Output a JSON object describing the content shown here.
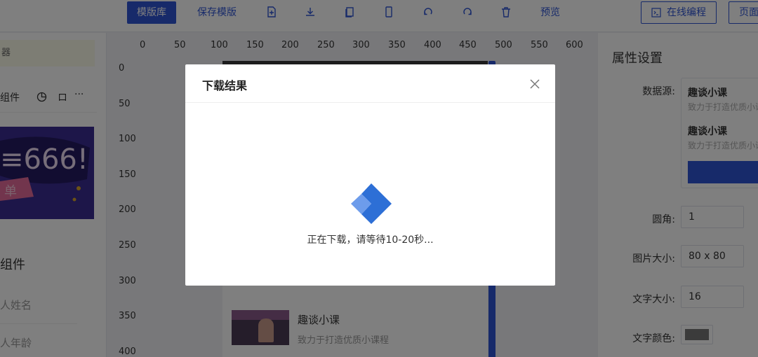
{
  "toolbar": {
    "template_lib": "模版库",
    "save_template": "保存模版",
    "preview": "预览",
    "online_coding": "在线编程",
    "page": "页面"
  },
  "left_panel": {
    "tab_component": "组件",
    "tab_more": "···",
    "banner_text": "≡666!",
    "banner_ribbon": "单",
    "components_title": "组件",
    "fields": [
      "人姓名",
      "人年龄"
    ]
  },
  "ruler": {
    "x_ticks": [
      "0",
      "50",
      "100",
      "150",
      "200",
      "250",
      "300",
      "350",
      "400",
      "450",
      "500",
      "550",
      "600"
    ],
    "y_ticks": [
      "0",
      "50",
      "100",
      "150",
      "200",
      "250",
      "300",
      "350",
      "400"
    ]
  },
  "canvas": {
    "item_title": "趣谈小课",
    "item_subtitle": "致力于打造优质小课程"
  },
  "right_panel": {
    "title": "属性设置",
    "datasource_label": "数据源:",
    "datasource_items": [
      {
        "title": "趣谈小课",
        "subtitle": "致力于打造优质小课"
      },
      {
        "title": "趣谈小课",
        "subtitle": "致力于打造优质小课"
      }
    ],
    "radius_label": "圆角:",
    "radius_value": "1",
    "image_size_label": "图片大小:",
    "image_size_value": "80 x 80",
    "font_size_label": "文字大小:",
    "font_size_value": "16",
    "text_color_label": "文字颜色:",
    "text_color_value": "#777777"
  },
  "modal": {
    "title": "下载结果",
    "message": "正在下载，请等待10-20秒..."
  },
  "colors": {
    "accent": "#2f55d4",
    "loader_dark": "#2d6fd6",
    "loader_light": "#6d9ceb"
  }
}
